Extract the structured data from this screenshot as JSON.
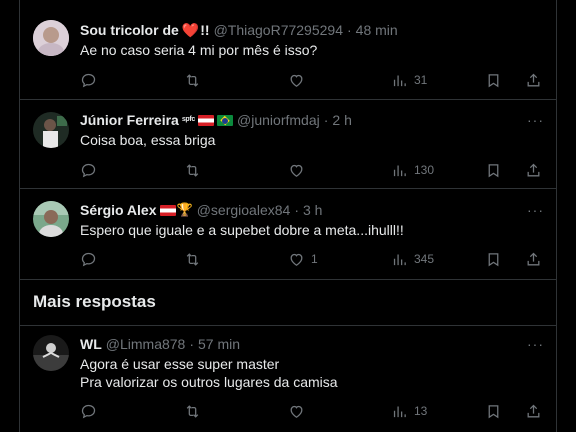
{
  "posts": [
    {
      "name": "Sou tricolor de",
      "emoji_after_name": "❤️",
      "suffix": "!!",
      "handle": "@ThiagoR77295294",
      "time": "48 min",
      "text": "Ae no caso seria 4 mi por mês é isso?",
      "views": "31",
      "likes": "",
      "avatar_color": "#d9c6d8"
    },
    {
      "name": "Júnior Ferreira",
      "badge": "spfc",
      "flags": [
        "sao-paulo-flag-icon",
        "brazil-flag-icon"
      ],
      "handle": "@juniorfmdaj",
      "time": "2 h",
      "text": "Coisa boa, essa briga",
      "views": "130",
      "likes": "",
      "avatar_color": "#2e4a3a"
    },
    {
      "name": "Sérgio Alex",
      "flags": [
        "sao-paulo-flag-icon",
        "trophy-icon"
      ],
      "handle": "@sergioalex84",
      "time": "3 h",
      "text": "Espero que iguale e a supebet dobre a meta...ihulll!!",
      "views": "345",
      "likes": "1",
      "avatar_color": "#5b8c6e"
    }
  ],
  "section_title": "Mais respostas",
  "more_posts": [
    {
      "name": "WL",
      "handle": "@Limma878",
      "time": "57 min",
      "text": "Agora é usar esse super master\nPra valorizar os outros lugares da camisa",
      "views": "13",
      "likes": "",
      "avatar_color": "#3a3a3a"
    }
  ],
  "separator": "·",
  "more_label": "···",
  "theme": {
    "background": "#000000",
    "text": "#e7e9ea",
    "muted": "#71767b",
    "border": "#2f3336"
  }
}
